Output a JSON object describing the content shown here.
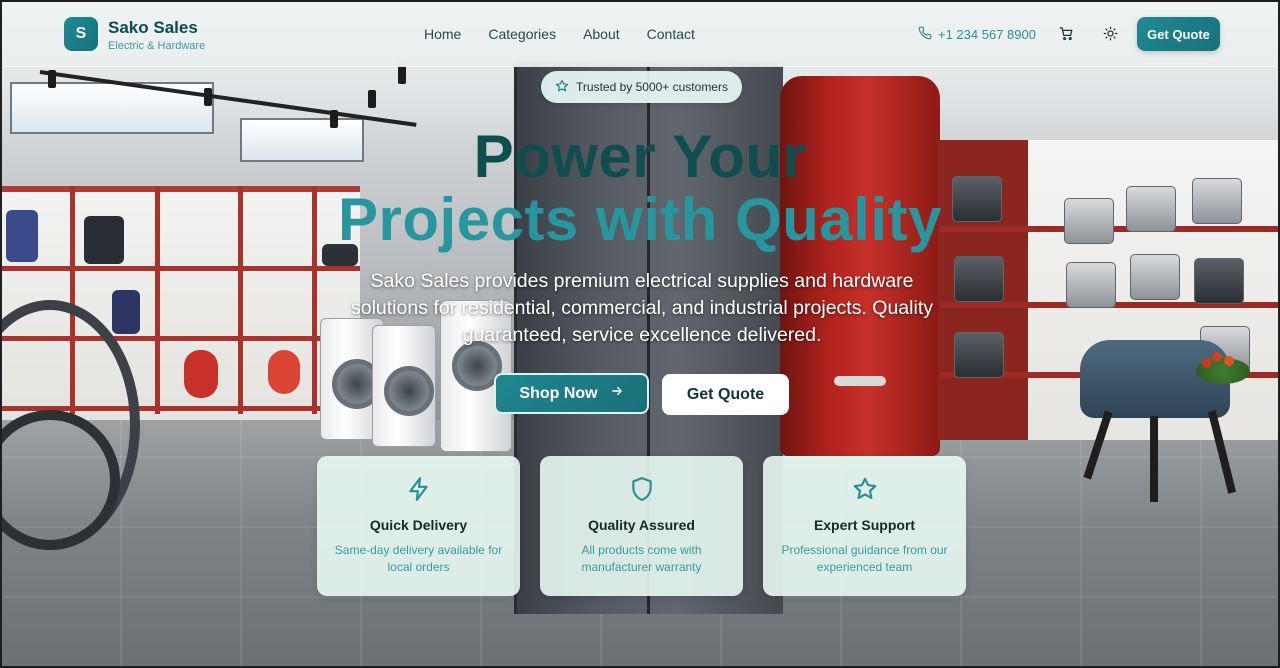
{
  "header": {
    "logo_letter": "S",
    "brand_name": "Sako Sales",
    "brand_tagline": "Electric & Hardware",
    "nav": [
      "Home",
      "Categories",
      "About",
      "Contact"
    ],
    "phone": "+1 234 567 8900",
    "quote_button": "Get Quote",
    "icons": [
      "phone-icon",
      "cart-icon",
      "sun-icon"
    ]
  },
  "hero": {
    "badge": "Trusted by 5000+ customers",
    "title_line1": "Power Your",
    "title_line2": "Projects with Quality",
    "subtitle": "Sako Sales provides premium electrical supplies and hardware solutions for residential, commercial, and industrial projects. Quality guaranteed, service excellence delivered.",
    "primary_button": "Shop Now",
    "secondary_button": "Get Quote"
  },
  "features": [
    {
      "icon": "lightning-icon",
      "title": "Quick Delivery",
      "desc": "Same-day delivery available for local orders"
    },
    {
      "icon": "shield-icon",
      "title": "Quality Assured",
      "desc": "All products come with manufacturer warranty"
    },
    {
      "icon": "star-icon",
      "title": "Expert Support",
      "desc": "Professional guidance from our experienced team"
    }
  ],
  "colors": {
    "brand_teal": "#1f8a93",
    "title_dark": "#0f4d4f",
    "title_light": "#27969e",
    "card_bg": "#e8f8f2"
  }
}
